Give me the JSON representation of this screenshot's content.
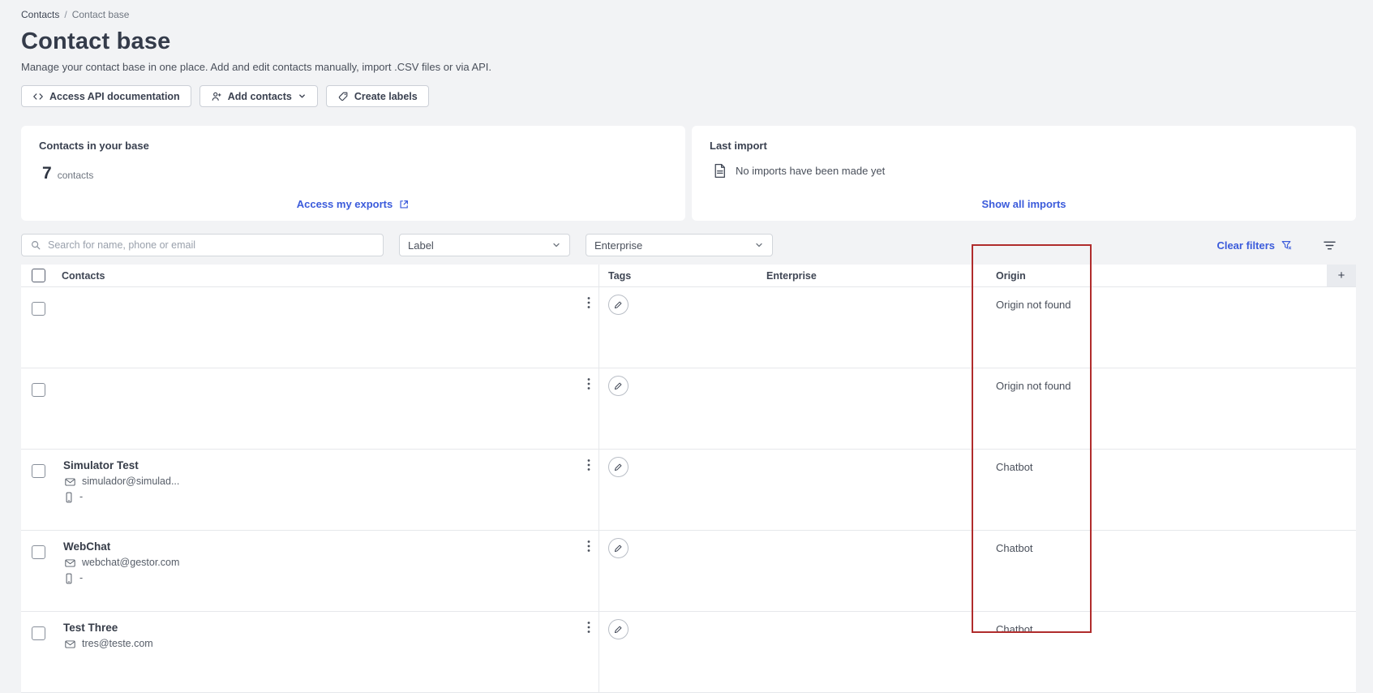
{
  "breadcrumb": {
    "items": [
      "Contacts",
      "Contact base"
    ],
    "separator": "/"
  },
  "header": {
    "title": "Contact base",
    "subtitle": "Manage your contact base in one place. Add and edit contacts manually, import .CSV files or via API."
  },
  "toolbar": {
    "access_api_label": "Access API documentation",
    "add_contacts_label": "Add contacts",
    "create_labels_label": "Create labels"
  },
  "cards": {
    "contacts_base": {
      "title": "Contacts in your base",
      "count": "7",
      "count_label": "contacts",
      "exports_link": "Access my exports"
    },
    "last_import": {
      "title": "Last import",
      "empty_text": "No imports have been made yet",
      "show_all_link": "Show all imports"
    }
  },
  "filters": {
    "search_placeholder": "Search for name, phone or email",
    "label_dropdown": "Label",
    "enterprise_dropdown": "Enterprise",
    "clear_filters_label": "Clear filters"
  },
  "table": {
    "columns": [
      "Contacts",
      "Tags",
      "Enterprise",
      "Origin"
    ],
    "add_column_label": "+",
    "rows": [
      {
        "name": "",
        "email": "",
        "phone": "",
        "origin": "Origin not found"
      },
      {
        "name": "",
        "email": "",
        "phone": "",
        "origin": "Origin not found"
      },
      {
        "name": "Simulator Test",
        "email": "simulador@simulad...",
        "phone": "-",
        "origin": "Chatbot"
      },
      {
        "name": "WebChat",
        "email": "webchat@gestor.com",
        "phone": "-",
        "origin": "Chatbot"
      },
      {
        "name": "Test Three",
        "email": "tres@teste.com",
        "phone": "",
        "origin": "Chatbot"
      }
    ]
  },
  "colors": {
    "accent": "#3b5bdb",
    "annotation": "#b02c2c"
  }
}
